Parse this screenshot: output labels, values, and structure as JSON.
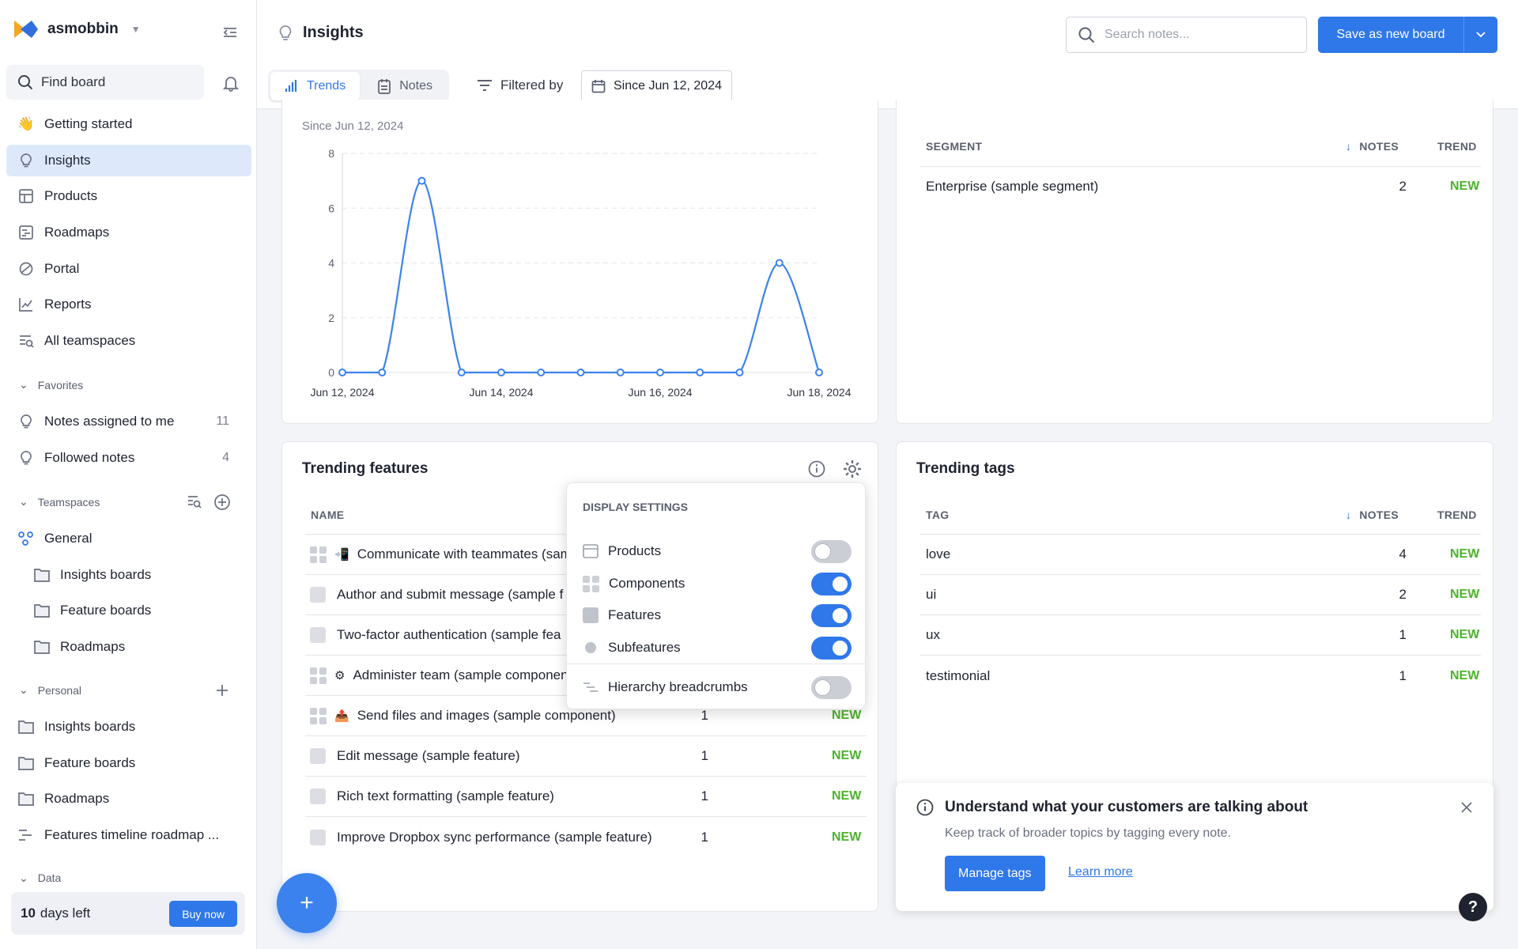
{
  "workspace": {
    "name": "asmobbin"
  },
  "sidebar": {
    "find_label": "Find board",
    "main_items": [
      {
        "label": "Getting started",
        "icon": "waving-hand-icon"
      },
      {
        "label": "Insights",
        "icon": "lightbulb-icon"
      },
      {
        "label": "Products",
        "icon": "products-icon"
      },
      {
        "label": "Roadmaps",
        "icon": "roadmap-icon"
      },
      {
        "label": "Portal",
        "icon": "portal-icon"
      },
      {
        "label": "Reports",
        "icon": "reports-icon"
      },
      {
        "label": "All teamspaces",
        "icon": "teamspaces-icon"
      }
    ],
    "favorites": {
      "title": "Favorites",
      "items": [
        {
          "label": "Notes assigned to me",
          "count": "11"
        },
        {
          "label": "Followed notes",
          "count": "4"
        }
      ]
    },
    "teamspaces": {
      "title": "Teamspaces",
      "general": "General",
      "items": [
        "Insights boards",
        "Feature boards",
        "Roadmaps"
      ]
    },
    "personal": {
      "title": "Personal",
      "items": [
        "Insights boards",
        "Feature boards",
        "Roadmaps",
        "Features timeline roadmap ..."
      ]
    },
    "data_title": "Data",
    "trial": {
      "days": "10",
      "text": "days left",
      "buy_label": "Buy now"
    }
  },
  "header": {
    "title": "Insights",
    "search_placeholder": "Search notes...",
    "save_label": "Save as new board",
    "tabs": [
      {
        "label": "Trends",
        "active": true
      },
      {
        "label": "Notes",
        "active": false
      }
    ],
    "filtered_by": "Filtered by",
    "since": "Since Jun 12, 2024"
  },
  "trend_card": {
    "subtitle": "Since Jun 12, 2024"
  },
  "chart_data": {
    "type": "line",
    "color": "#3b82ee",
    "ylim": [
      0,
      8
    ],
    "yticks": [
      0,
      2,
      4,
      6,
      8
    ],
    "xticks": [
      "Jun 12, 2024",
      "Jun 14, 2024",
      "Jun 16, 2024",
      "Jun 18, 2024"
    ],
    "x": [
      0,
      0.5,
      1,
      1.5,
      2,
      2.5,
      3,
      3.5,
      4,
      4.5,
      5,
      5.5,
      6
    ],
    "series": [
      {
        "values": [
          0,
          0,
          7,
          0,
          0,
          0,
          0,
          0,
          0,
          0,
          0,
          4,
          0
        ]
      }
    ]
  },
  "segments": {
    "col_segment": "SEGMENT",
    "col_notes": "NOTES",
    "col_trend": "TREND",
    "rows": [
      {
        "name": "Enterprise (sample segment)",
        "notes": "2",
        "trend": "NEW"
      }
    ]
  },
  "features": {
    "title": "Trending features",
    "col_name": "NAME",
    "rows": [
      {
        "kind": "component",
        "emoji": "📲",
        "name": "Communicate with teammates (sam",
        "notes": "",
        "trend": ""
      },
      {
        "kind": "feature",
        "emoji": "",
        "name": "Author and submit message (sample f",
        "notes": "",
        "trend": ""
      },
      {
        "kind": "feature",
        "emoji": "",
        "name": "Two-factor authentication (sample fea",
        "notes": "",
        "trend": ""
      },
      {
        "kind": "component",
        "emoji": "⚙",
        "name": "Administer team (sample componen",
        "notes": "",
        "trend": ""
      },
      {
        "kind": "component",
        "emoji": "📤",
        "name": "Send files and images (sample component)",
        "notes": "1",
        "trend": "NEW"
      },
      {
        "kind": "feature",
        "emoji": "",
        "name": "Edit message (sample feature)",
        "notes": "1",
        "trend": "NEW"
      },
      {
        "kind": "feature",
        "emoji": "",
        "name": "Rich text formatting (sample feature)",
        "notes": "1",
        "trend": "NEW"
      },
      {
        "kind": "feature",
        "emoji": "",
        "name": "Improve Dropbox sync performance (sample feature)",
        "notes": "1",
        "trend": "NEW"
      }
    ]
  },
  "display_settings": {
    "title": "DISPLAY SETTINGS",
    "items": [
      {
        "label": "Products",
        "on": false
      },
      {
        "label": "Components",
        "on": true
      },
      {
        "label": "Features",
        "on": true
      },
      {
        "label": "Subfeatures",
        "on": true
      }
    ],
    "breadcrumbs": {
      "label": "Hierarchy breadcrumbs",
      "on": false
    }
  },
  "tags": {
    "title": "Trending tags",
    "col_tag": "TAG",
    "col_notes": "NOTES",
    "col_trend": "TREND",
    "rows": [
      {
        "name": "love",
        "notes": "4",
        "trend": "NEW"
      },
      {
        "name": "ui",
        "notes": "2",
        "trend": "NEW"
      },
      {
        "name": "ux",
        "notes": "1",
        "trend": "NEW"
      },
      {
        "name": "testimonial",
        "notes": "1",
        "trend": "NEW"
      }
    ]
  },
  "banner": {
    "title": "Understand what your customers are talking about",
    "text": "Keep track of broader topics by tagging every note.",
    "primary": "Manage tags",
    "link": "Learn more"
  },
  "fab_label": "+",
  "help_label": "?"
}
